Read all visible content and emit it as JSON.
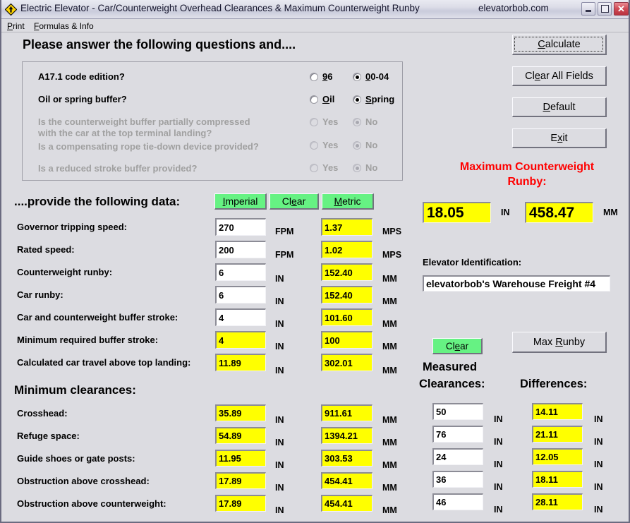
{
  "window": {
    "title": "Electric Elevator - Car/Counterweight Overhead Clearances & Maximum Counterweight Runby",
    "brand": "elevatorbob.com",
    "icon": "elevator-diamond-icon",
    "minimize_glyph": "minimize-icon",
    "maximize_glyph": "maximize-icon",
    "close_glyph": "✕"
  },
  "menu": {
    "items": [
      {
        "mnemonic": "P",
        "rest": "rint"
      },
      {
        "mnemonic": "F",
        "rest": "ormulas & Info"
      }
    ]
  },
  "questions": {
    "heading": "Please answer the following questions and....",
    "rows": [
      {
        "label": "A17.1 code edition?",
        "enabled": true,
        "option_a": {
          "mnemonic": "9",
          "rest": "6",
          "selected": false
        },
        "option_b": {
          "mnemonic": "0",
          "rest": "0-04",
          "selected": true
        }
      },
      {
        "label": "Oil or spring buffer?",
        "enabled": true,
        "option_a": {
          "mnemonic": "O",
          "rest": "il",
          "selected": false
        },
        "option_b": {
          "mnemonic": "S",
          "rest": "pring",
          "selected": true
        }
      },
      {
        "label": "Is the counterweight buffer partially compressed",
        "label2": "with the car at the top terminal landing?",
        "enabled": false,
        "option_a": {
          "mnemonic": "",
          "rest": "Yes",
          "selected": false
        },
        "option_b": {
          "mnemonic": "",
          "rest": "No",
          "selected": true
        }
      },
      {
        "label": "Is a compensating rope tie-down device provided?",
        "enabled": false,
        "option_a": {
          "mnemonic": "",
          "rest": "Yes",
          "selected": false
        },
        "option_b": {
          "mnemonic": "",
          "rest": "No",
          "selected": true
        }
      },
      {
        "label": "Is a reduced stroke buffer provided?",
        "enabled": false,
        "option_a": {
          "mnemonic": "",
          "rest": "Yes",
          "selected": false
        },
        "option_b": {
          "mnemonic": "",
          "rest": "No",
          "selected": true
        }
      }
    ]
  },
  "action_buttons": {
    "calculate": {
      "mnemonic": "C",
      "rest": "alculate"
    },
    "clear_all": {
      "pre": "Cl",
      "mnemonic": "e",
      "rest": "ar All Fields"
    },
    "default": {
      "mnemonic": "D",
      "rest": "efault"
    },
    "exit": {
      "pre": "E",
      "mnemonic": "x",
      "rest": "it"
    },
    "max_runby": {
      "pre": "Max ",
      "mnemonic": "R",
      "rest": "unby"
    }
  },
  "max_runby_panel": {
    "title_line1": "Maximum Counterweight",
    "title_line2": "Runby:",
    "value_in": "18.05",
    "unit_in": "IN",
    "value_mm": "458.47",
    "unit_mm": "MM"
  },
  "elevator_id": {
    "label": "Elevator Identification:",
    "value": "elevatorbob's Warehouse Freight #4"
  },
  "data_section": {
    "heading": "....provide the following data:",
    "unit_buttons": {
      "imperial": {
        "mnemonic": "I",
        "rest": "mperial"
      },
      "clear": {
        "pre": "Cl",
        "mnemonic": "e",
        "rest": "ar"
      },
      "metric": {
        "mnemonic": "M",
        "rest": "etric"
      }
    },
    "rows": [
      {
        "label": "Governor tripping speed:",
        "imp": "270",
        "imp_unit": "FPM",
        "imp_yellow": false,
        "met": "1.37",
        "met_unit": "MPS"
      },
      {
        "label": "Rated speed:",
        "imp": "200",
        "imp_unit": "FPM",
        "imp_yellow": false,
        "met": "1.02",
        "met_unit": "MPS"
      },
      {
        "label": "Counterweight runby:",
        "imp": "6",
        "imp_unit": "IN",
        "imp_yellow": false,
        "met": "152.40",
        "met_unit": "MM"
      },
      {
        "label": "Car runby:",
        "imp": "6",
        "imp_unit": "IN",
        "imp_yellow": false,
        "met": "152.40",
        "met_unit": "MM"
      },
      {
        "label": "Car and counterweight buffer stroke:",
        "imp": "4",
        "imp_unit": "IN",
        "imp_yellow": false,
        "met": "101.60",
        "met_unit": "MM"
      },
      {
        "label": "Minimum required buffer stroke:",
        "imp": "4",
        "imp_unit": "IN",
        "imp_yellow": true,
        "met": "100",
        "met_unit": "MM"
      },
      {
        "label": "Calculated car travel above top landing:",
        "imp": "11.89",
        "imp_unit": "IN",
        "imp_yellow": true,
        "met": "302.01",
        "met_unit": "MM"
      }
    ]
  },
  "clearances_section": {
    "heading": "Minimum clearances:",
    "measured_heading_line1": "Measured",
    "measured_heading_line2": "Clearances:",
    "differences_heading": "Differences:",
    "clear_button": {
      "pre": "Cl",
      "mnemonic": "e",
      "rest": "ar"
    },
    "rows": [
      {
        "label": "Crosshead:",
        "min_in": "35.89",
        "min_mm": "911.61",
        "measured": "50",
        "difference": "14.11",
        "unit_in": "IN",
        "unit_mm": "MM"
      },
      {
        "label": "Refuge space:",
        "min_in": "54.89",
        "min_mm": "1394.21",
        "measured": "76",
        "difference": "21.11",
        "unit_in": "IN",
        "unit_mm": "MM"
      },
      {
        "label": "Guide shoes or gate posts:",
        "min_in": "11.95",
        "min_mm": "303.53",
        "measured": "24",
        "difference": "12.05",
        "unit_in": "IN",
        "unit_mm": "MM"
      },
      {
        "label": "Obstruction above crosshead:",
        "min_in": "17.89",
        "min_mm": "454.41",
        "measured": "36",
        "difference": "18.11",
        "unit_in": "IN",
        "unit_mm": "MM"
      },
      {
        "label": "Obstruction above counterweight:",
        "min_in": "17.89",
        "min_mm": "454.41",
        "measured": "46",
        "difference": "28.11",
        "unit_in": "IN",
        "unit_mm": "MM"
      }
    ]
  },
  "colors": {
    "window_bg": "#dcdce1",
    "field_yellow": "#ffff00",
    "button_green": "#66f283",
    "accent_red": "#ff0000",
    "title_close": "#d04a56"
  }
}
